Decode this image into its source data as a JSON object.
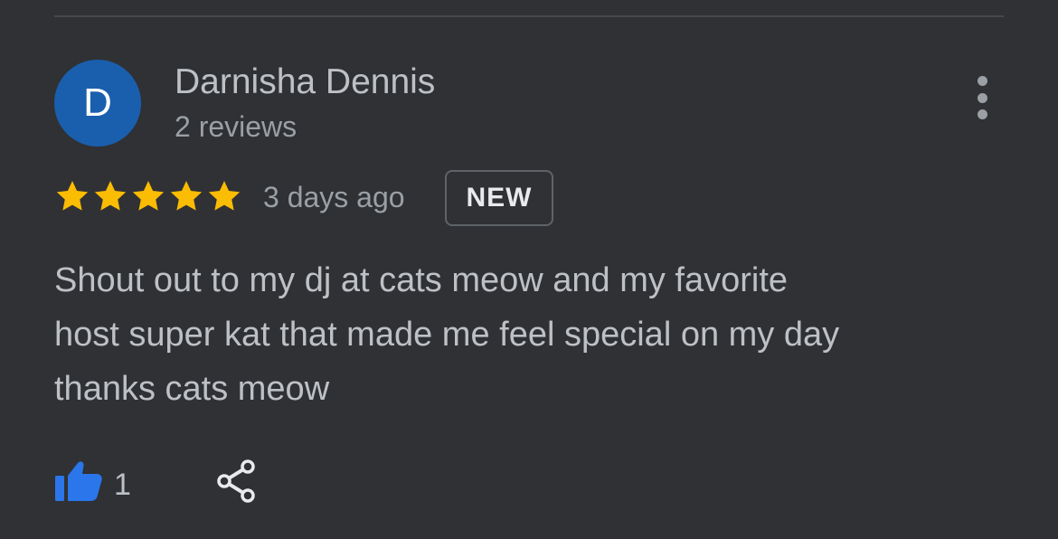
{
  "reviewer": {
    "avatar_letter": "D",
    "avatar_color": "#1a5fae",
    "name": "Darnisha Dennis",
    "review_count": "2 reviews"
  },
  "review": {
    "rating": 5,
    "max_rating": 5,
    "star_color": "#fbbc04",
    "date": "3 days ago",
    "badge": "NEW",
    "text_lines": [
      "Shout out to my dj at cats meow and my favorite",
      "host super kat that made me feel special on my day",
      "thanks cats meow"
    ]
  },
  "actions": {
    "like_count": "1",
    "like_icon": "thumbs-up-icon",
    "like_color": "#2a76ea",
    "share_icon": "share-icon",
    "more_icon": "more-vertical-icon"
  },
  "theme": {
    "background": "#303134"
  }
}
